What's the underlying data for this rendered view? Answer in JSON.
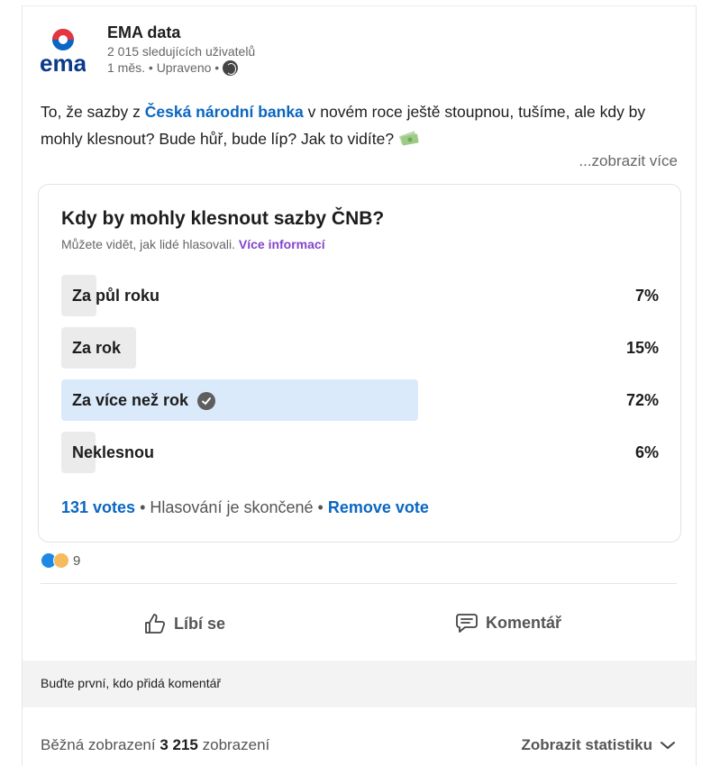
{
  "author": {
    "name": "EMA data",
    "logo_text": "ema",
    "followers": "2 015 sledujících uživatelů",
    "meta": "1 měs. • Upraveno •"
  },
  "post": {
    "text_before": "To, že sazby z ",
    "mention": "Česká národní banka",
    "text_after": " v novém roce ještě stoupnou, tušíme, ale kdy by mohly klesnout? Bude hůř, bude líp? Jak to vidíte?",
    "see_more": "...zobrazit více"
  },
  "poll": {
    "question": "Kdy by mohly klesnout sazby ČNB?",
    "subtitle": "Můžete vidět, jak lidé hlasovali.",
    "more_info": "Více informací",
    "options": [
      {
        "label": "Za půl roku",
        "percent": "7%",
        "value": 7,
        "selected": false
      },
      {
        "label": "Za rok",
        "percent": "15%",
        "value": 15,
        "selected": false
      },
      {
        "label": "Za více než rok",
        "percent": "72%",
        "value": 72,
        "selected": true
      },
      {
        "label": "Neklesnou",
        "percent": "6%",
        "value": 6,
        "selected": false
      }
    ],
    "votes": "131 votes",
    "status": "Hlasování je skončené",
    "remove_vote": "Remove vote"
  },
  "reactions": {
    "count": "9",
    "types": [
      "clap-icon",
      "idea-icon"
    ]
  },
  "actions": {
    "like": "Líbí se",
    "comment": "Komentář"
  },
  "comments": {
    "prompt": "Buďte první, kdo přidá komentář"
  },
  "stats": {
    "prefix": "Běžná zobrazení",
    "value": "3 215",
    "suffix": "zobrazení",
    "button": "Zobrazit statistiku"
  },
  "colors": {
    "link": "#0a66c2",
    "purple_link": "#8344cc",
    "selected_fill": "#dbeafa",
    "bar_fill": "#ebebeb"
  }
}
